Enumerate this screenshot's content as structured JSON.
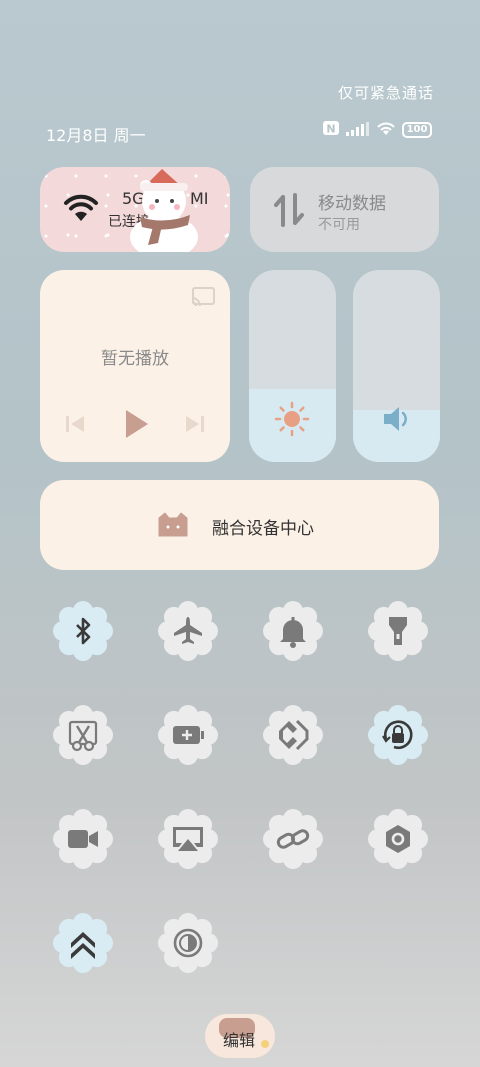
{
  "status_bar": {
    "emergency_text": "仅可紧急通话",
    "date_text": "12月8日 周一",
    "battery_level": "100"
  },
  "wifi_tile": {
    "network_name": "5G",
    "network_name_suffix": "MI",
    "status": "已连接"
  },
  "mobile_data_tile": {
    "title": "移动数据",
    "status": "不可用"
  },
  "media_tile": {
    "status": "暂无播放"
  },
  "brightness_slider": {
    "level": 0.38
  },
  "volume_slider": {
    "level": 0.27
  },
  "fusion_tile": {
    "label": "融合设备中心"
  },
  "toggles": [
    {
      "name": "bluetooth",
      "icon": "bluetooth-icon",
      "active": true
    },
    {
      "name": "airplane-mode",
      "icon": "airplane-icon",
      "active": false
    },
    {
      "name": "ring-mode",
      "icon": "bell-icon",
      "active": false
    },
    {
      "name": "flashlight",
      "icon": "flashlight-icon",
      "active": false
    },
    {
      "name": "screenshot",
      "icon": "scissors-icon",
      "active": false
    },
    {
      "name": "battery-saver",
      "icon": "battery-plus-icon",
      "active": false
    },
    {
      "name": "nfc",
      "icon": "nfc-icon",
      "active": false
    },
    {
      "name": "rotation-lock",
      "icon": "rotation-lock-icon",
      "active": true
    },
    {
      "name": "screen-recorder",
      "icon": "video-camera-icon",
      "active": false
    },
    {
      "name": "screen-cast",
      "icon": "cast-icon",
      "active": false
    },
    {
      "name": "link",
      "icon": "link-icon",
      "active": false
    },
    {
      "name": "settings",
      "icon": "hexagon-settings-icon",
      "active": false
    },
    {
      "name": "performance",
      "icon": "double-chevron-up-icon",
      "active": true
    },
    {
      "name": "dark-mode",
      "icon": "contrast-icon",
      "active": false
    }
  ],
  "edit_button": {
    "label": "编辑"
  },
  "colors": {
    "toggle_active": "#d9ecf4",
    "toggle_inactive": "#ececec",
    "icon": "#7a7a7a",
    "icon_active": "#3a3a3a"
  }
}
